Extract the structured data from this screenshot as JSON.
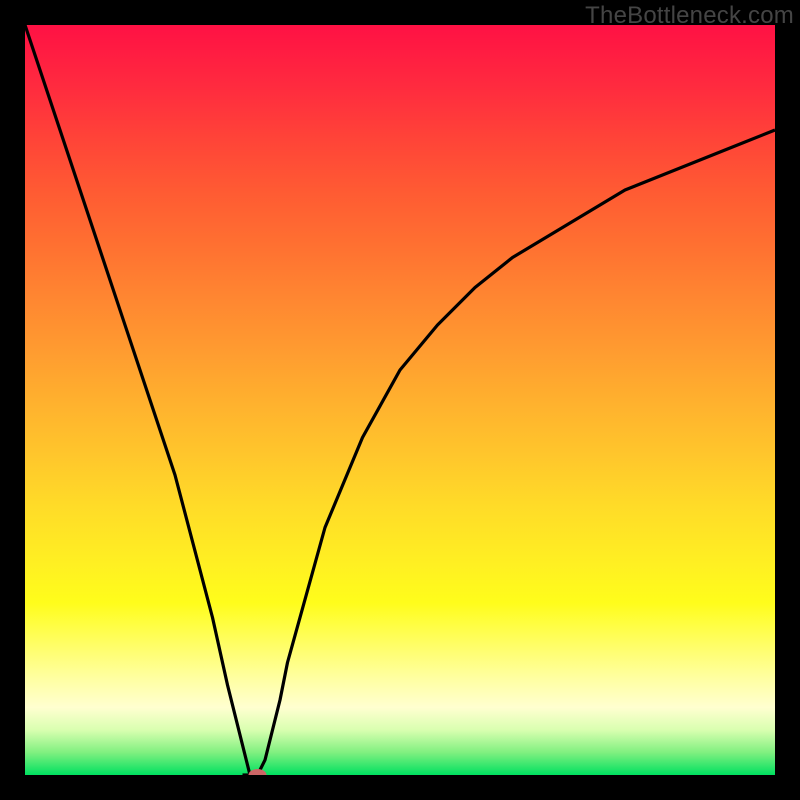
{
  "source_label": "TheBottleneck.com",
  "chart_data": {
    "type": "line",
    "title": "",
    "xlabel": "",
    "ylabel": "",
    "xlim": [
      0,
      100
    ],
    "ylim": [
      0,
      100
    ],
    "grid": false,
    "background_gradient": [
      "#ff1144",
      "#ff5a33",
      "#ff9a30",
      "#ffdb28",
      "#ffffa0",
      "#00e060"
    ],
    "series": [
      {
        "name": "bottleneck-curve",
        "stroke": "#000000",
        "x": [
          0,
          5,
          10,
          15,
          20,
          25,
          27,
          29,
          30,
          31,
          32,
          34,
          35,
          40,
          45,
          50,
          55,
          60,
          65,
          70,
          75,
          80,
          85,
          90,
          95,
          100
        ],
        "y": [
          100,
          85,
          70,
          55,
          40,
          21,
          12,
          4,
          0,
          0,
          2,
          10,
          15,
          33,
          45,
          54,
          60,
          65,
          69,
          72,
          75,
          78,
          80,
          82,
          84,
          86
        ]
      }
    ],
    "marker": {
      "x": 31,
      "y": 0,
      "color": "#cc6666",
      "rx": 9,
      "ry": 6
    },
    "floor_line": {
      "y": 0,
      "x0": 29,
      "x1": 31,
      "color": "#000000"
    }
  }
}
